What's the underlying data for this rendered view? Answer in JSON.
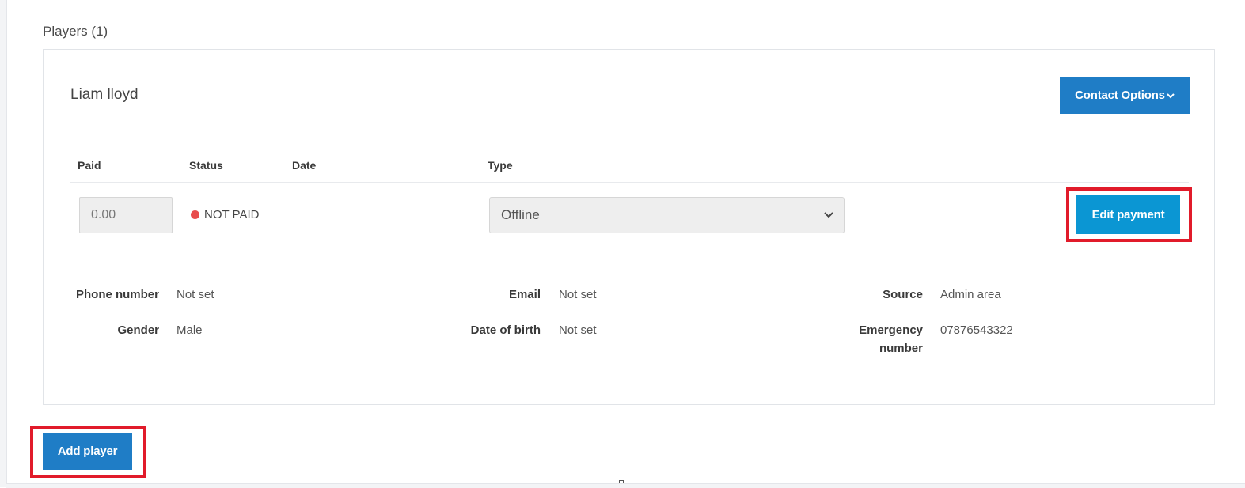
{
  "section": {
    "title": "Players (1)"
  },
  "player": {
    "name": "Liam lloyd",
    "contact_button": "Contact Options",
    "payment": {
      "headers": {
        "paid": "Paid",
        "status": "Status",
        "date": "Date",
        "type": "Type"
      },
      "paid_value": "0.00",
      "status_text": "NOT PAID",
      "date_value": "",
      "type_value": "Offline",
      "edit_button": "Edit payment"
    },
    "details": {
      "phone_label": "Phone number",
      "phone_value": "Not set",
      "email_label": "Email",
      "email_value": "Not set",
      "source_label": "Source",
      "source_value": "Admin area",
      "gender_label": "Gender",
      "gender_value": "Male",
      "dob_label": "Date of birth",
      "dob_value": "Not set",
      "emergency_label_line1": "Emergency",
      "emergency_label_line2": "number",
      "emergency_value": "07876543322"
    }
  },
  "add_player_button": "Add player",
  "colors": {
    "primary": "#1f7dc6",
    "edit_button": "#0b96d3",
    "status_not_paid": "#e84c4c",
    "highlight": "#e11b2a"
  },
  "icons": {
    "dropdown": "chevron-down-icon",
    "status": "status-dot-icon"
  }
}
